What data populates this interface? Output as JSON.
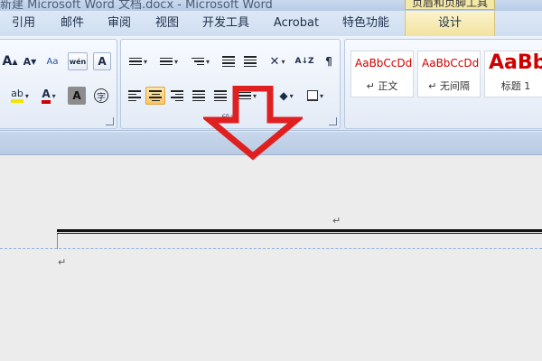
{
  "window": {
    "title": "新建 Microsoft Word 文档.docx - Microsoft Word",
    "context_tab_title": "页眉和页脚工具"
  },
  "tabs": [
    "引用",
    "邮件",
    "审阅",
    "视图",
    "开发工具",
    "Acrobat",
    "特色功能",
    "设计"
  ],
  "font_group": {
    "grow_font": "A",
    "shrink_font": "A",
    "change_case": "Aa",
    "phonetic_guide": "wén",
    "char_border": "A",
    "highlight": "ab",
    "font_color": "A",
    "char_shading": "A",
    "enclose_char": "字"
  },
  "paragraph_group": {
    "label": "段落",
    "sort": "A↓Z",
    "show_marks": "¶"
  },
  "styles_group": {
    "items": [
      {
        "sample": "AaBbCcDdE",
        "name": "↵ 正文"
      },
      {
        "sample": "AaBbCcDdE",
        "name": "↵ 无间隔"
      },
      {
        "sample": "AaBb",
        "name": "标题 1"
      }
    ]
  },
  "document": {
    "paragraph_mark": "↵"
  },
  "colors": {
    "highlight": "#f2e600",
    "font_color": "#d00000",
    "arrow": "#e02020"
  }
}
